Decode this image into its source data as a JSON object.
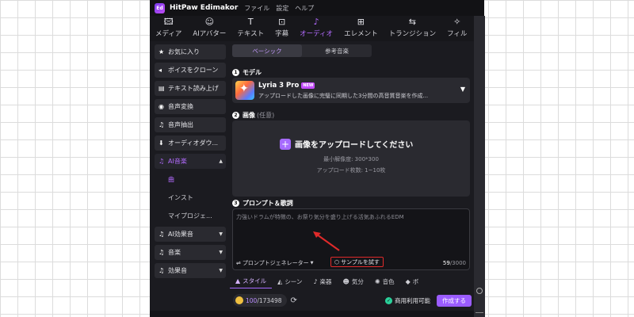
{
  "titlebar": {
    "app_name": "HitPaw Edimakor",
    "menu": [
      "ファイル",
      "設定",
      "ヘルプ"
    ]
  },
  "top_tabs": [
    {
      "label": "メディア",
      "icon": "media-icon",
      "glyph": "🖾"
    },
    {
      "label": "AIアバター",
      "icon": "ai-avatar-icon",
      "glyph": "☺"
    },
    {
      "label": "テキスト",
      "icon": "text-icon",
      "glyph": "T"
    },
    {
      "label": "字幕",
      "icon": "subtitle-icon",
      "glyph": "⊡"
    },
    {
      "label": "オーディオ",
      "icon": "audio-icon",
      "glyph": "♪"
    },
    {
      "label": "エレメント",
      "icon": "element-icon",
      "glyph": "⊞"
    },
    {
      "label": "トランジション",
      "icon": "transition-icon",
      "glyph": "⇆"
    },
    {
      "label": "フィル",
      "icon": "filter-icon",
      "glyph": "✧"
    }
  ],
  "sidebar": {
    "items": [
      {
        "label": "お気に入り",
        "glyph": "★"
      },
      {
        "label": "ボイスをクローン",
        "glyph": "◂"
      },
      {
        "label": "テキスト読み上げ",
        "glyph": "▤"
      },
      {
        "label": "音声変換",
        "glyph": "◉"
      },
      {
        "label": "音声抽出",
        "glyph": "♫"
      },
      {
        "label": "オーディオダウ...",
        "glyph": "⬇"
      },
      {
        "label": "AI音楽",
        "glyph": "♫"
      }
    ],
    "subitems": [
      "曲",
      "インスト",
      "マイプロジェ..."
    ],
    "more_items": [
      {
        "label": "AI効果音",
        "glyph": "♫"
      },
      {
        "label": "音楽",
        "glyph": "♫"
      },
      {
        "label": "効果音",
        "glyph": "♫"
      }
    ]
  },
  "segment": {
    "basic": "ベーシック",
    "reference": "参考音楽"
  },
  "model_section": {
    "num": "1",
    "title": "モデル",
    "name": "Lyria 3 Pro",
    "badge": "NEW",
    "desc": "アップロードした画像に完璧に同期した3分間の高音質音楽を作成..."
  },
  "image_section": {
    "num": "2",
    "title": "画像",
    "optional": "(任意)",
    "upload_label": "画像をアップロードしてください",
    "min_res": "最小解像度: 300*300",
    "max_count": "アップロード枚数: 1~10枚"
  },
  "prompt_section": {
    "num": "3",
    "title": "プロンプト＆歌詞",
    "placeholder": "力強いドラムが特徴の、お祭り気分を盛り上げる活気あふれるEDM",
    "generator": "プロンプトジェネレーター",
    "sample": "サンプルを試す",
    "count_current": "59",
    "count_max": "/3000"
  },
  "style_tabs": [
    {
      "label": "スタイル",
      "glyph": "▲"
    },
    {
      "label": "シーン",
      "glyph": "◭"
    },
    {
      "label": "楽器",
      "glyph": "♪"
    },
    {
      "label": "気分",
      "glyph": "☻"
    },
    {
      "label": "音色",
      "glyph": "✺"
    },
    {
      "label": "ボ",
      "glyph": "◆"
    }
  ],
  "bottom": {
    "credits_current": "100",
    "credits_total": "/173498",
    "commercial": "商用利用可能",
    "create": "作成する"
  },
  "colors": {
    "accent": "#9b5cff",
    "highlight_box": "#e02a2a",
    "panel": "#2a2a30"
  }
}
